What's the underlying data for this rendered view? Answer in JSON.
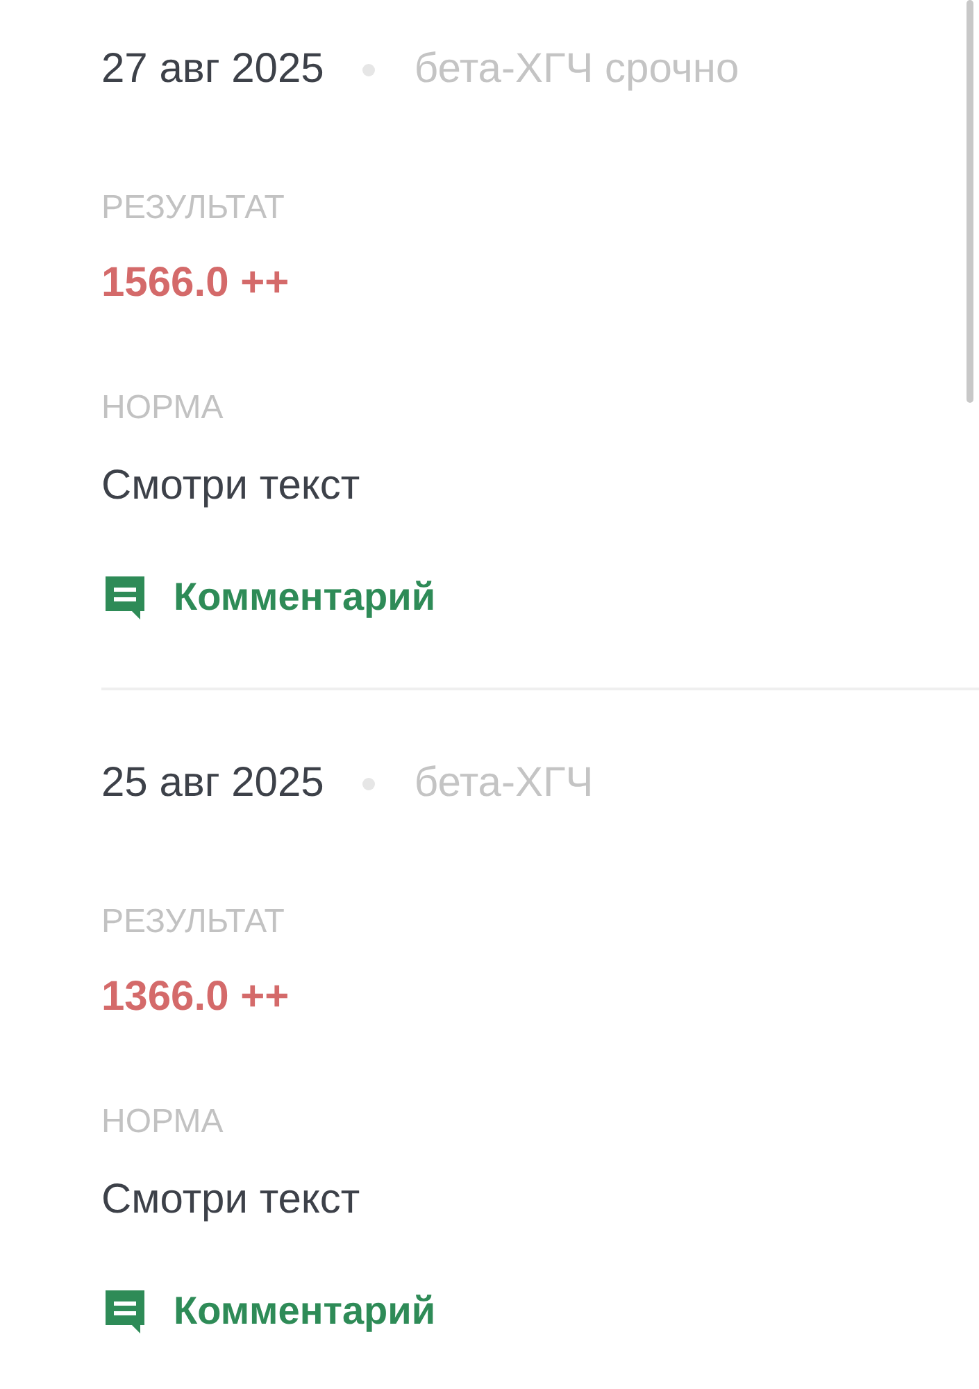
{
  "entries": [
    {
      "date": "27 авг 2025",
      "tag": "бета-ХГЧ срочно",
      "result_label": "РЕЗУЛЬТАТ",
      "result": "1566.0 ++",
      "norm_label": "НОРМА",
      "norm": "Смотри текст",
      "comment": "Комментарий"
    },
    {
      "date": "25 авг 2025",
      "tag": "бета-ХГЧ",
      "result_label": "РЕЗУЛЬТАТ",
      "result": "1366.0 ++",
      "norm_label": "НОРМА",
      "norm": "Смотри текст",
      "comment": "Комментарий"
    }
  ]
}
